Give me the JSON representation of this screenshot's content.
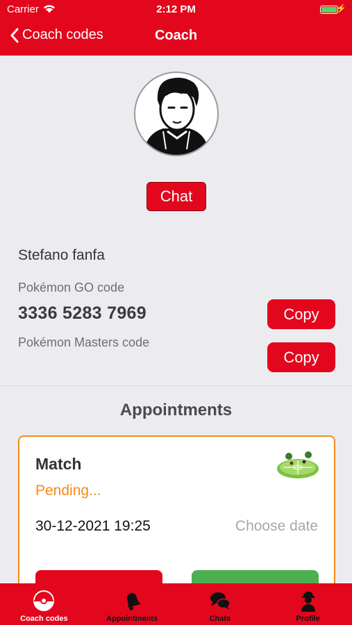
{
  "status_bar": {
    "carrier": "Carrier",
    "time": "2:12 PM"
  },
  "nav": {
    "back_label": "Coach codes",
    "title": "Coach"
  },
  "profile": {
    "chat_label": "Chat",
    "name": "Stefano fanfa",
    "go_code_label": "Pokémon GO code",
    "go_code": "3336 5283 7969",
    "masters_code_label": "Pokémon Masters code",
    "copy_label": "Copy"
  },
  "appointments": {
    "title": "Appointments",
    "items": [
      {
        "type": "Match",
        "status": "Pending...",
        "datetime": "30-12-2021 19:25",
        "choose_date_label": "Choose date"
      }
    ]
  },
  "tabbar": {
    "items": [
      {
        "label": "Coach codes",
        "icon": "pokeball-icon",
        "active": true
      },
      {
        "label": "Appointments",
        "icon": "bell-icon",
        "active": false
      },
      {
        "label": "Chats",
        "icon": "chat-bubbles-icon",
        "active": false
      },
      {
        "label": "Profile",
        "icon": "trainer-icon",
        "active": false
      }
    ]
  },
  "colors": {
    "primary": "#e3071d",
    "pending": "#f28c1a",
    "accept": "#4caf50",
    "background": "#ececf0"
  }
}
